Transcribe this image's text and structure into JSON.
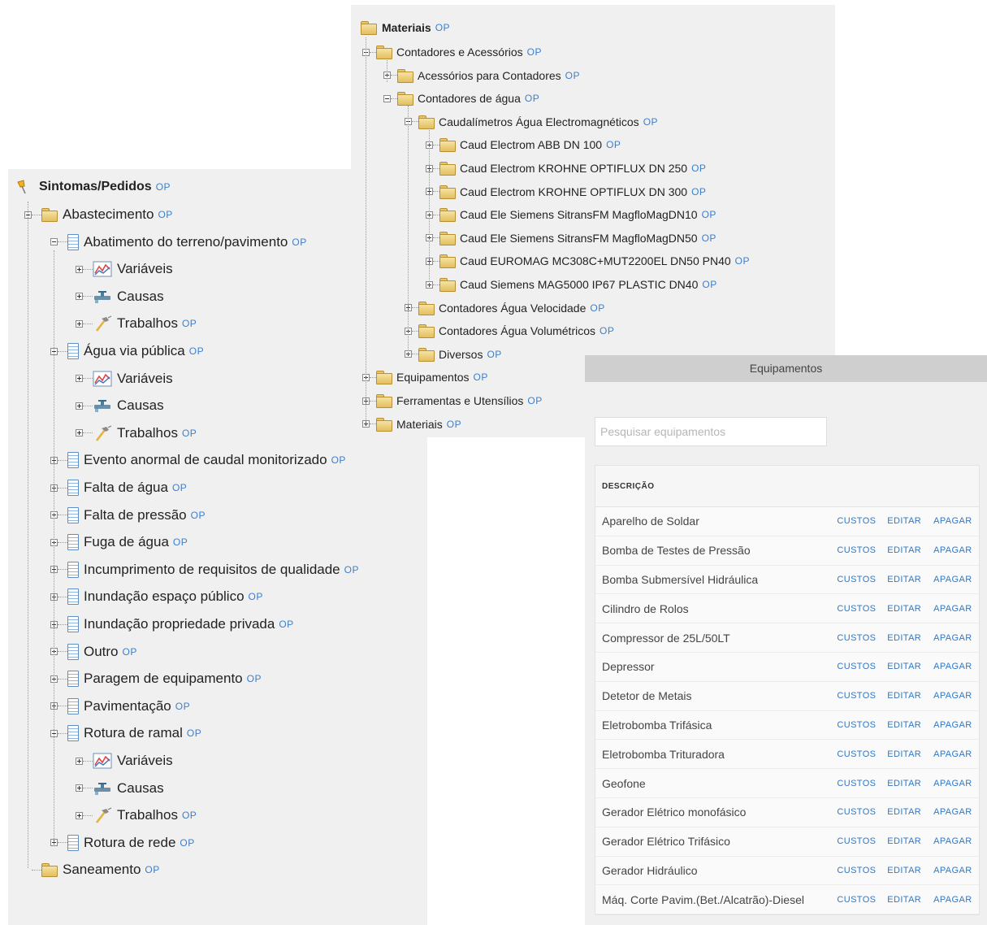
{
  "symptoms_tree": {
    "root": "Sintomas/Pedidos",
    "op": "OP",
    "nodes": [
      {
        "label": "Abastecimento",
        "icon": "folder",
        "level": 1,
        "expander": "minus",
        "op": true
      },
      {
        "label": "Abatimento do terreno/pavimento",
        "icon": "doc",
        "level": 2,
        "expander": "minus",
        "op": true
      },
      {
        "label": "Variáveis",
        "icon": "chart",
        "level": 3,
        "expander": "plus",
        "op": false
      },
      {
        "label": "Causas",
        "icon": "tap",
        "level": 3,
        "expander": "plus",
        "op": false
      },
      {
        "label": "Trabalhos",
        "icon": "hammer",
        "level": 3,
        "expander": "plus",
        "op": true
      },
      {
        "label": "Água via pública",
        "icon": "doc",
        "level": 2,
        "expander": "minus",
        "op": true
      },
      {
        "label": "Variáveis",
        "icon": "chart",
        "level": 3,
        "expander": "plus",
        "op": false
      },
      {
        "label": "Causas",
        "icon": "tap",
        "level": 3,
        "expander": "plus",
        "op": false
      },
      {
        "label": "Trabalhos",
        "icon": "hammer",
        "level": 3,
        "expander": "plus",
        "op": true
      },
      {
        "label": "Evento anormal de caudal monitorizado",
        "icon": "doc",
        "level": 2,
        "expander": "plus",
        "op": true
      },
      {
        "label": "Falta de água",
        "icon": "doc",
        "level": 2,
        "expander": "plus",
        "op": true
      },
      {
        "label": "Falta de pressão",
        "icon": "doc",
        "level": 2,
        "expander": "plus",
        "op": true
      },
      {
        "label": "Fuga de água",
        "icon": "doc",
        "level": 2,
        "expander": "plus",
        "op": true
      },
      {
        "label": "Incumprimento de requisitos de qualidade",
        "icon": "doc",
        "level": 2,
        "expander": "plus",
        "op": true
      },
      {
        "label": "Inundação espaço público",
        "icon": "doc",
        "level": 2,
        "expander": "plus",
        "op": true
      },
      {
        "label": "Inundação propriedade privada",
        "icon": "doc",
        "level": 2,
        "expander": "plus",
        "op": true
      },
      {
        "label": "Outro",
        "icon": "doc",
        "level": 2,
        "expander": "plus",
        "op": true
      },
      {
        "label": "Paragem de equipamento",
        "icon": "doc",
        "level": 2,
        "expander": "plus",
        "op": true
      },
      {
        "label": "Pavimentação",
        "icon": "doc",
        "level": 2,
        "expander": "plus",
        "op": true
      },
      {
        "label": "Rotura de ramal",
        "icon": "doc",
        "level": 2,
        "expander": "minus",
        "op": true
      },
      {
        "label": "Variáveis",
        "icon": "chart",
        "level": 3,
        "expander": "plus",
        "op": false
      },
      {
        "label": "Causas",
        "icon": "tap",
        "level": 3,
        "expander": "plus",
        "op": false
      },
      {
        "label": "Trabalhos",
        "icon": "hammer",
        "level": 3,
        "expander": "plus",
        "op": true
      },
      {
        "label": "Rotura de rede",
        "icon": "doc",
        "level": 2,
        "expander": "plus",
        "op": true
      },
      {
        "label": "Saneamento",
        "icon": "folder",
        "level": 1,
        "expander": "none",
        "op": true
      }
    ]
  },
  "materials_tree": {
    "root": "Materiais",
    "op": "OP",
    "nodes": [
      {
        "label": "Contadores e Acessórios",
        "level": 1,
        "expander": "minus"
      },
      {
        "label": "Acessórios para Contadores",
        "level": 2,
        "expander": "plus"
      },
      {
        "label": "Contadores de água",
        "level": 2,
        "expander": "minus"
      },
      {
        "label": "Caudalímetros Água Electromagnéticos",
        "level": 3,
        "expander": "minus"
      },
      {
        "label": "Caud Electrom ABB DN 100",
        "level": 4,
        "expander": "plus"
      },
      {
        "label": "Caud Electrom KROHNE OPTIFLUX DN 250",
        "level": 4,
        "expander": "plus"
      },
      {
        "label": "Caud Electrom KROHNE OPTIFLUX DN 300",
        "level": 4,
        "expander": "plus"
      },
      {
        "label": "Caud Ele Siemens SitransFM MagfloMagDN10",
        "level": 4,
        "expander": "plus"
      },
      {
        "label": "Caud Ele Siemens SitransFM MagfloMagDN50",
        "level": 4,
        "expander": "plus"
      },
      {
        "label": "Caud EUROMAG MC308C+MUT2200EL DN50 PN40",
        "level": 4,
        "expander": "plus"
      },
      {
        "label": "Caud Siemens MAG5000 IP67 PLASTIC DN40",
        "level": 4,
        "expander": "plus"
      },
      {
        "label": "Contadores Água Velocidade",
        "level": 3,
        "expander": "plus"
      },
      {
        "label": "Contadores Água Volumétricos",
        "level": 3,
        "expander": "plus"
      },
      {
        "label": "Diversos",
        "level": 3,
        "expander": "plus"
      },
      {
        "label": "Equipamentos",
        "level": 1,
        "expander": "plus"
      },
      {
        "label": "Ferramentas e Utensílios",
        "level": 1,
        "expander": "plus"
      },
      {
        "label": "Materiais",
        "level": 1,
        "expander": "plus"
      }
    ]
  },
  "equipment": {
    "title": "Equipamentos",
    "search_placeholder": "Pesquisar equipamentos",
    "column_description": "DESCRIÇÃO",
    "actions": {
      "costs": "CUSTOS",
      "edit": "EDITAR",
      "delete": "APAGAR"
    },
    "rows": [
      "Aparelho de Soldar",
      "Bomba de Testes de Pressão",
      "Bomba Submersível Hidráulica",
      "Cilindro de Rolos",
      "Compressor de 25L/50LT",
      "Depressor",
      "Detetor de Metais",
      "Eletrobomba Trifásica",
      "Eletrobomba Trituradora",
      "Geofone",
      "Gerador Elétrico monofásico",
      "Gerador Elétrico Trifásico",
      "Gerador Hidráulico",
      "Máq. Corte Pavim.(Bet./Alcatrão)-Diesel"
    ]
  }
}
